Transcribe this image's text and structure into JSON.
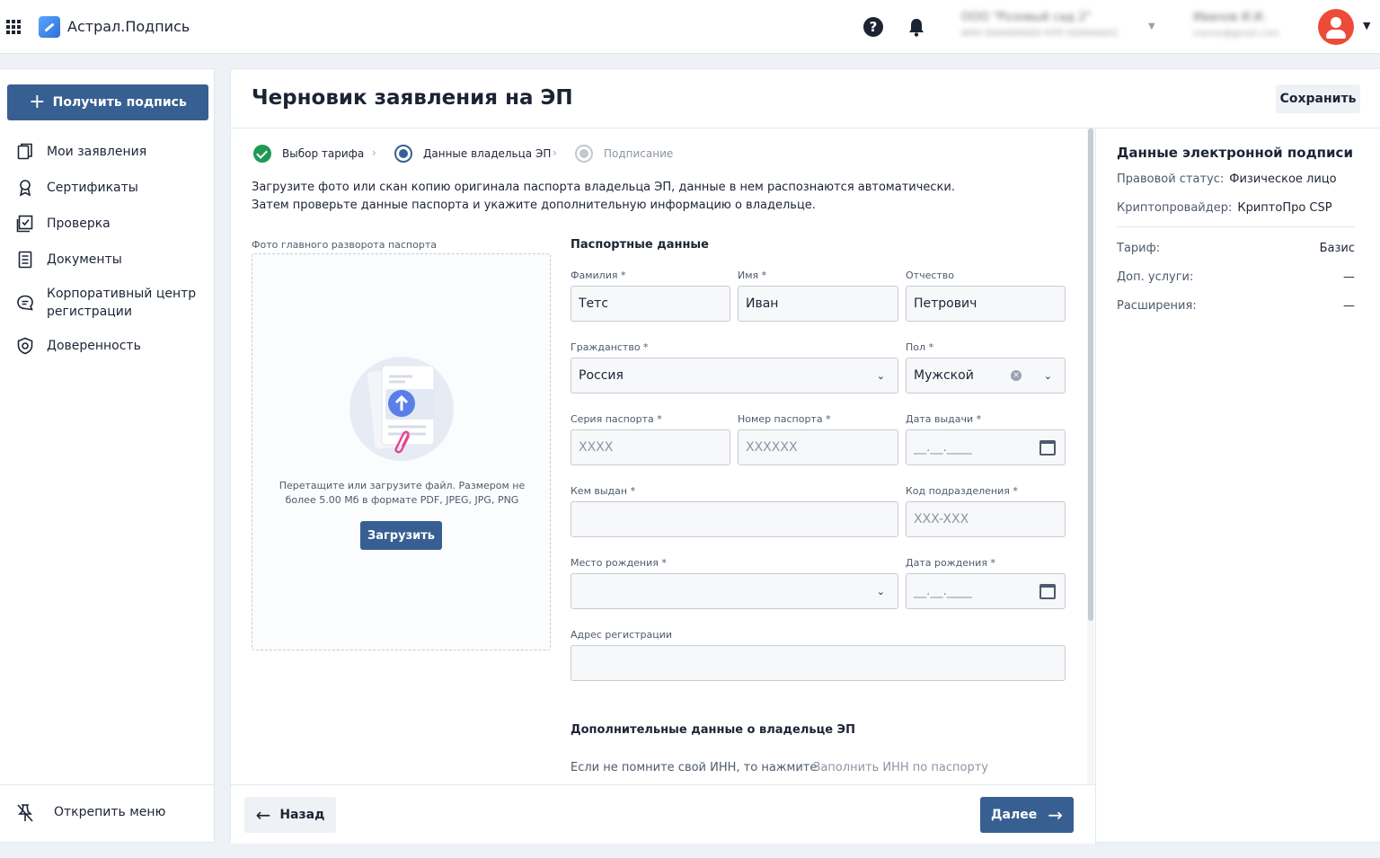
{
  "header": {
    "app_title": "Астрал.Подпись",
    "org_name": "ООО \"Розовый сад 2\"",
    "org_details": "ИНН 0000000000 КПП 000000001",
    "user_name": "Иванов И.И.",
    "user_email": "ivanov@gmail.com",
    "help_glyph": "?"
  },
  "sidebar": {
    "get_signature_label": "Получить подпись",
    "items": [
      {
        "label": "Мои заявления",
        "icon": "documents-copy-icon"
      },
      {
        "label": "Сертификаты",
        "icon": "award-icon"
      },
      {
        "label": "Проверка",
        "icon": "check-square-icon"
      },
      {
        "label": "Документы",
        "icon": "document-lines-icon"
      },
      {
        "label": "Корпоративный центр регистрации",
        "icon": "chat-icon"
      },
      {
        "label": "Доверенность",
        "icon": "shield-icon"
      }
    ],
    "unpin_label": "Открепить меню"
  },
  "page": {
    "title": "Черновик заявления на ЭП",
    "save_label": "Сохранить"
  },
  "stepper": {
    "steps": [
      {
        "label": "Выбор тарифа",
        "state": "done"
      },
      {
        "label": "Данные владельца ЭП",
        "state": "active"
      },
      {
        "label": "Подписание",
        "state": "todo"
      }
    ]
  },
  "intro": {
    "line1": "Загрузите фото или скан копию оригинала паспорта владельца ЭП, данные в нем распознаются автоматически.",
    "line2": "Затем проверьте данные паспорта и укажите дополнительную информацию о владельце."
  },
  "upload": {
    "label": "Фото главного разворота паспорта",
    "hint": "Перетащите или загрузите файл. Размером не более 5.00 Мб в формате PDF, JPEG, JPG, PNG",
    "button_label": "Загрузить"
  },
  "form": {
    "passport_title": "Паспортные данные",
    "surname": {
      "label": "Фамилия *",
      "value": "Тетс"
    },
    "name": {
      "label": "Имя *",
      "value": "Иван"
    },
    "patronymic": {
      "label": "Отчество",
      "value": "Петрович"
    },
    "citizenship": {
      "label": "Гражданство *",
      "value": "Россия"
    },
    "gender": {
      "label": "Пол *",
      "value": "Мужской"
    },
    "passport_series": {
      "label": "Серия паспорта *",
      "placeholder": "XXXX"
    },
    "passport_number": {
      "label": "Номер паспорта *",
      "placeholder": "XXXXXX"
    },
    "issue_date": {
      "label": "Дата выдачи *",
      "placeholder": "__.__.____"
    },
    "issued_by": {
      "label": "Кем выдан *",
      "placeholder": ""
    },
    "division_code": {
      "label": "Код подразделения *",
      "placeholder": "XXX-XXX"
    },
    "birth_place": {
      "label": "Место рождения *",
      "value": ""
    },
    "birth_date": {
      "label": "Дата рождения *",
      "placeholder": "__.__.____"
    },
    "address": {
      "label": "Адрес регистрации",
      "placeholder": ""
    },
    "additional_title": "Дополнительные данные о владельце ЭП",
    "inn_note": "Если не помните свой ИНН, то нажмите",
    "inn_link": "Заполнить ИНН по паспорту"
  },
  "footer": {
    "back_label": "Назад",
    "next_label": "Далее"
  },
  "right_panel": {
    "title": "Данные электронной подписи",
    "legal_status_key": "Правовой статус:",
    "legal_status_value": "Физическое лицо",
    "crypto_key": "Криптопровайдер:",
    "crypto_value": "КриптоПро CSP",
    "tariff_key": "Тариф:",
    "tariff_value": "Базис",
    "extra_key": "Доп. услуги:",
    "extra_value": "—",
    "ext_key": "Расширения:",
    "ext_value": "—"
  },
  "colors": {
    "accent": "#385f91",
    "success": "#1f9a54",
    "avatar": "#ee4a3a"
  }
}
